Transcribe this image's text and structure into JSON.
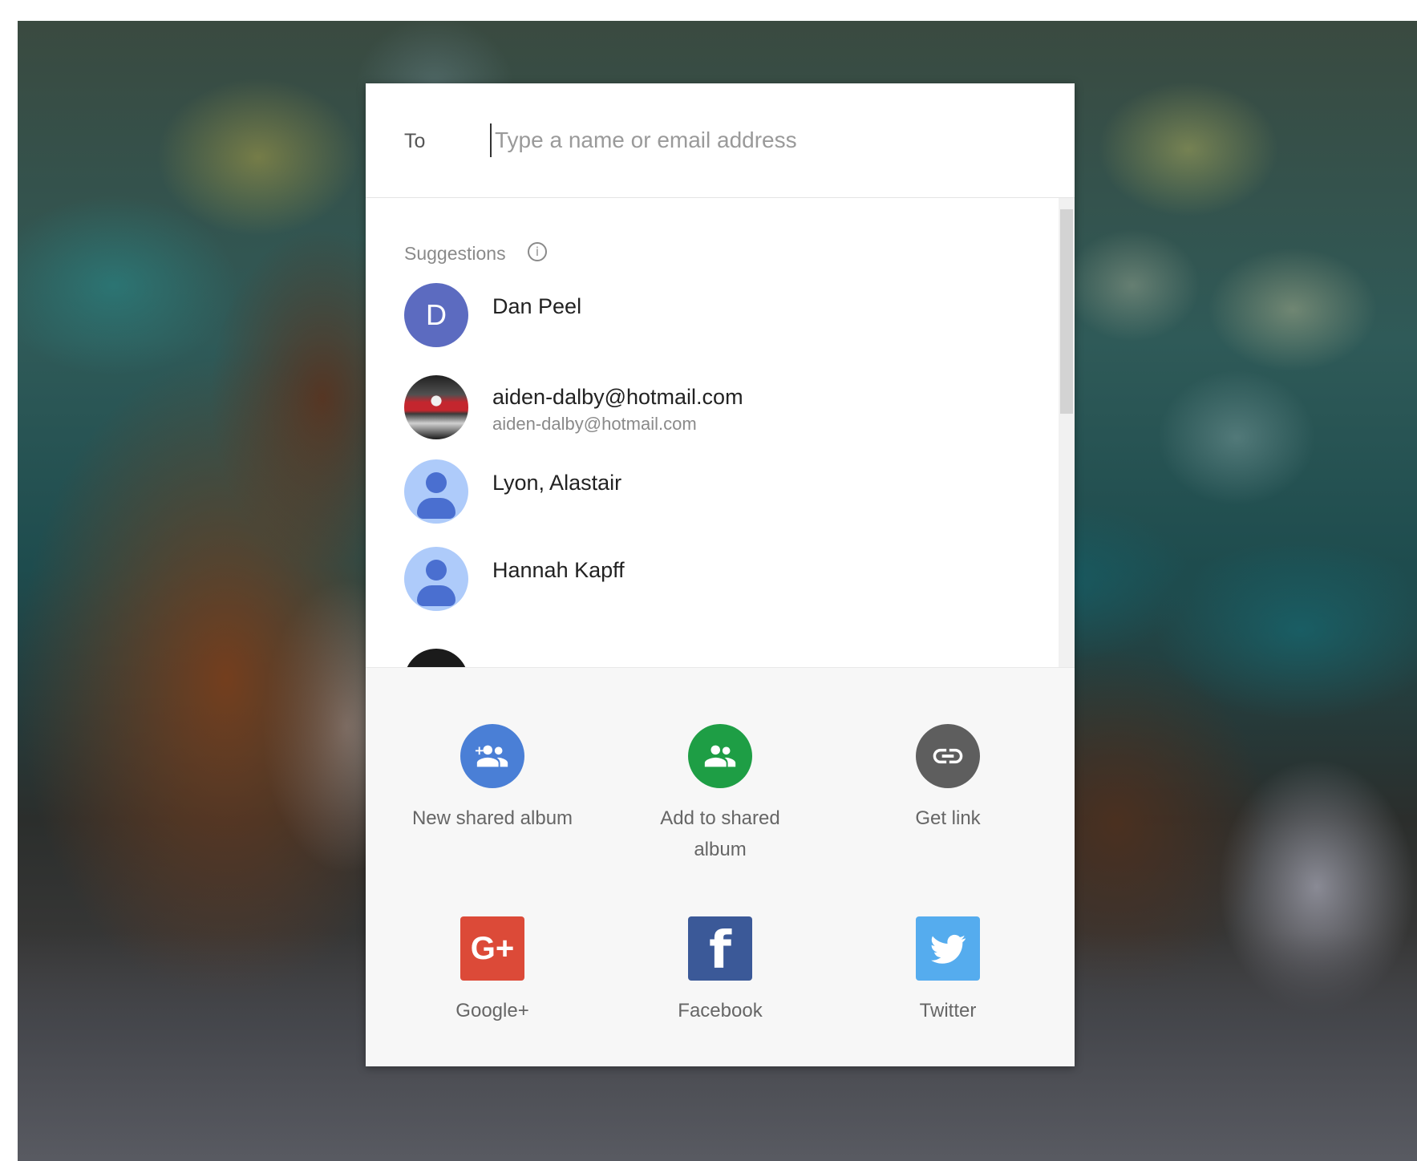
{
  "dialog": {
    "to_label": "To",
    "to_placeholder": "Type a name or email address"
  },
  "suggestions": {
    "title": "Suggestions",
    "info_icon_glyph": "i",
    "contacts": [
      {
        "name": "Dan Peel",
        "subtitle": "",
        "avatar": "letter",
        "avatar_letter": "D",
        "avatar_color": "#5c6bc0"
      },
      {
        "name": "aiden-dalby@hotmail.com",
        "subtitle": "aiden-dalby@hotmail.com",
        "avatar": "photo"
      },
      {
        "name": "Lyon, Alastair",
        "subtitle": "",
        "avatar": "person-icon",
        "avatar_color": "#aecbfa"
      },
      {
        "name": "Hannah Kapff",
        "subtitle": "",
        "avatar": "person-icon",
        "avatar_color": "#aecbfa"
      }
    ]
  },
  "actions": [
    {
      "label": "New shared album",
      "icon": "add-group-icon",
      "color": "#4a7fd6"
    },
    {
      "label": "Add to shared album",
      "icon": "group-icon",
      "color": "#1e9e45"
    },
    {
      "label": "Get link",
      "icon": "link-icon",
      "color": "#5e5e5e"
    },
    {
      "label": "Google+",
      "icon": "google-plus-icon",
      "color": "#dc4a38",
      "glyph": "G+"
    },
    {
      "label": "Facebook",
      "icon": "facebook-icon",
      "color": "#3b5998",
      "glyph": "f"
    },
    {
      "label": "Twitter",
      "icon": "twitter-icon",
      "color": "#55acee"
    }
  ]
}
